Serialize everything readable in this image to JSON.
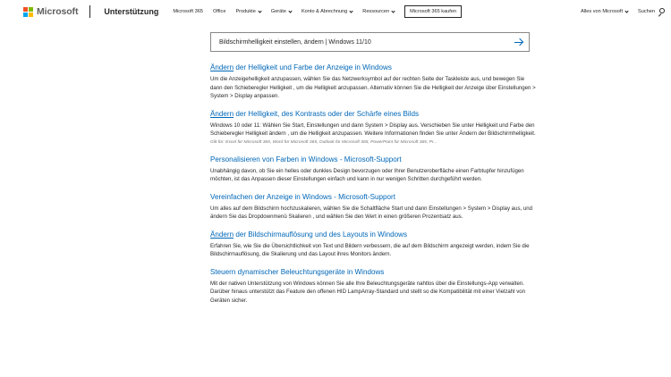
{
  "header": {
    "brand": "Microsoft",
    "section": "Unterstützung",
    "nav": [
      {
        "label": "Microsoft 365",
        "chevron": false
      },
      {
        "label": "Office",
        "chevron": false
      },
      {
        "label": "Produkte",
        "chevron": true
      },
      {
        "label": "Geräte",
        "chevron": true
      },
      {
        "label": "Konto & Abrechnung",
        "chevron": true
      },
      {
        "label": "Ressourcen",
        "chevron": true
      }
    ],
    "cta": "Microsoft 365 kaufen",
    "all_microsoft": "Alles von Microsoft",
    "search_label": "Suchen",
    "logo_colors": [
      "#f25022",
      "#7fba00",
      "#00a4ef",
      "#ffb900"
    ]
  },
  "search": {
    "query": "Bildschirmhelligkeit einstellen, ändern | Windows 11/10",
    "submit_icon": "arrow-right-icon"
  },
  "results": [
    {
      "title_lead": "Ändern",
      "title_rest": " der Helligkeit und Farbe der Anzeige in Windows",
      "description": "Um die Anzeigehelligkeit anzupassen, wählen Sie das Netzwerksymbol auf der rechten Seite der Taskleiste aus, und bewegen Sie dann den Schieberegler Helligkeit , um die Helligkeit anzupassen. Alternativ können Sie die Helligkeit der Anzeige über Einstellungen > System > Display anpassen.",
      "meta": ""
    },
    {
      "title_lead": "Ändern",
      "title_rest": " der Helligkeit, des Kontrasts oder der Schärfe eines Bilds",
      "description": "Windows 10 oder 11: Wählen Sie Start, Einstellungen und dann System > Display aus. Verschieben Sie unter Helligkeit und Farbe den Schieberegler Helligkeit ändern , um die Helligkeit anzupassen. Weitere Informationen finden Sie unter Ändern der Bildschirmhelligkeit.",
      "meta": "Gilt für: Excel für Microsoft 365, Word für Microsoft 365, Outlook für Microsoft 365, PowerPoint für Microsoft 365, Pr..."
    },
    {
      "title_lead": "",
      "title_rest": "Personalisieren von Farben in Windows - Microsoft-Support",
      "description": "Unabhängig davon, ob Sie ein helles oder dunkles Design bevorzugen oder Ihrer Benutzeroberfläche einen Farbtupfer hinzufügen möchten, ist das Anpassen dieser Einstellungen einfach und kann in nur wenigen Schritten durchgeführt werden.",
      "meta": ""
    },
    {
      "title_lead": "",
      "title_rest": "Vereinfachen der Anzeige in Windows - Microsoft-Support",
      "description": "Um alles auf dem Bildschirm hochzuskalieren, wählen Sie die Schaltfläche Start und dann Einstellungen > System > Display aus, und ändern Sie das Dropdownmenü Skalieren , und wählen Sie den Wert in einen größeren Prozentsatz aus.",
      "meta": ""
    },
    {
      "title_lead": "Ändern",
      "title_rest": " der Bildschirmauflösung und des Layouts in Windows",
      "description": "Erfahren Sie, wie Sie die Übersichtlichkeit von Text und Bildern verbessern, die auf dem Bildschirm angezeigt werden, indem Sie die Bildschirmauflösung, die Skalierung und das Layout ihres Monitors ändern.",
      "meta": ""
    },
    {
      "title_lead": "",
      "title_rest": "Steuern dynamischer Beleuchtungsgeräte in Windows",
      "description": "Mit der nativen Unterstützung von Windows können Sie alle Ihre Beleuchtungsgeräte nahtlos über die Einstellungs-App verwalten. Darüber hinaus unterstützt das Feature den offenen HID LampArray-Standard und stellt so die Kompatibilität mit einer Vielzahl von Geräten sicher.",
      "meta": ""
    }
  ],
  "colors": {
    "link": "#0067b8",
    "text": "#262626",
    "meta": "#737373"
  }
}
